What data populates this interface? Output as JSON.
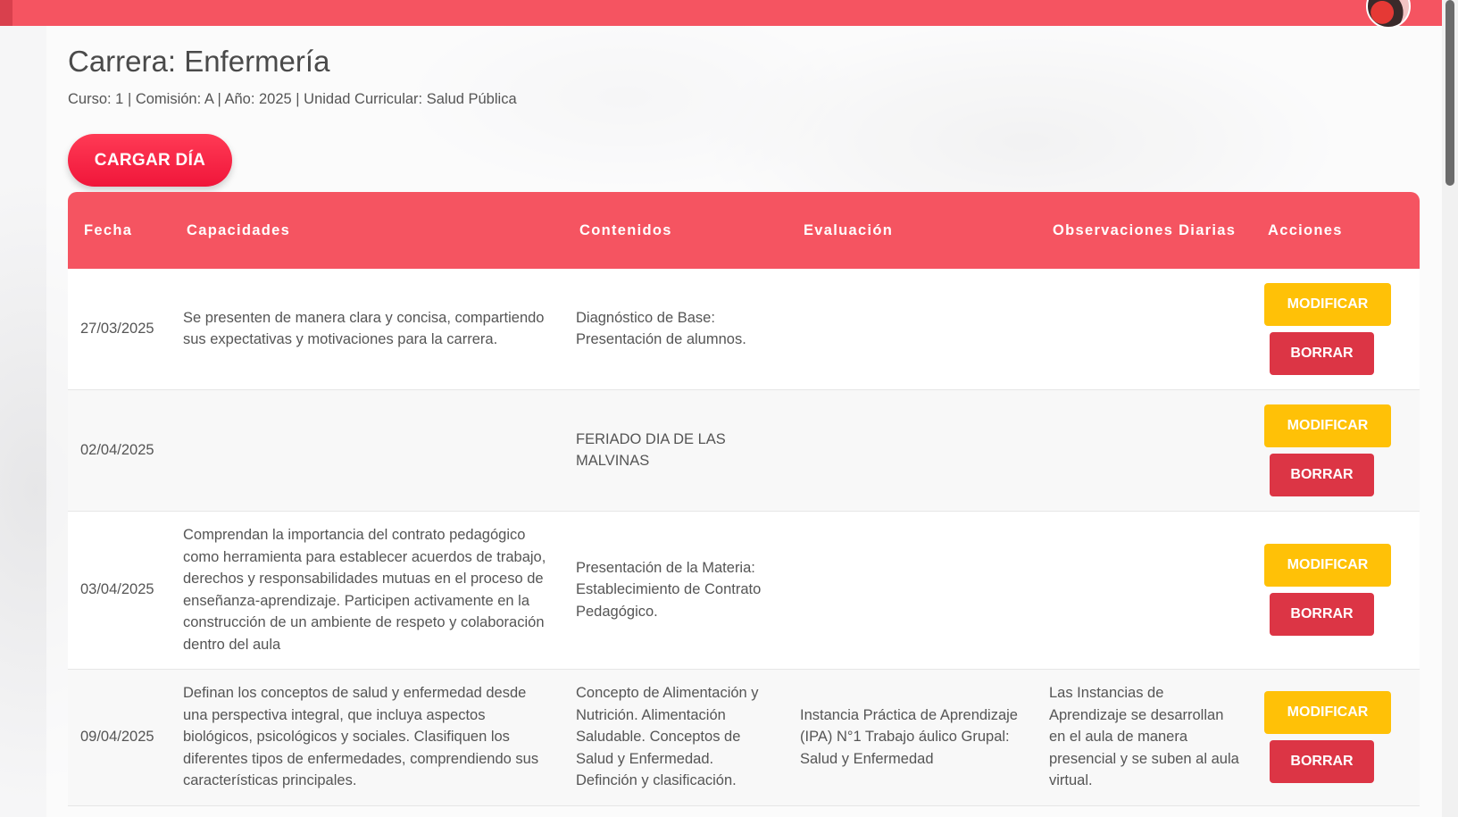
{
  "header": {
    "avatar_icon": "user-avatar",
    "bar_color": "#f55461"
  },
  "page": {
    "title": "Carrera: Enfermería",
    "subtitle": "Curso: 1 | Comisión: A | Año: 2025 | Unidad Curricular: Salud Pública",
    "cargar_label": "CARGAR DÍA"
  },
  "table": {
    "columns": [
      "Fecha",
      "Capacidades",
      "Contenidos",
      "Evaluación",
      "Observaciones Diarias",
      "Acciones"
    ],
    "modify_label": "MODIFICAR",
    "delete_label": "BORRAR",
    "rows": [
      {
        "fecha": "27/03/2025",
        "capacidades": "Se presenten de manera clara y concisa, compartiendo sus expectativas y motivaciones para la carrera.",
        "contenidos": "Diagnóstico de Base: Presentación de alumnos.",
        "evaluacion": "",
        "observaciones": ""
      },
      {
        "fecha": "02/04/2025",
        "capacidades": "",
        "contenidos": "FERIADO DIA DE LAS MALVINAS",
        "evaluacion": "",
        "observaciones": ""
      },
      {
        "fecha": "03/04/2025",
        "capacidades": "Comprendan la importancia del contrato pedagógico como herramienta para establecer acuerdos de trabajo, derechos y responsabilidades mutuas en el proceso de enseñanza-aprendizaje. Participen activamente en la construcción de un ambiente de respeto y colaboración dentro del aula",
        "contenidos": "Presentación de la Materia: Establecimiento de Contrato Pedagógico.",
        "evaluacion": "",
        "observaciones": ""
      },
      {
        "fecha": "09/04/2025",
        "capacidades": "Definan los conceptos de salud y enfermedad desde una perspectiva integral, que incluya aspectos biológicos, psicológicos y sociales. Clasifiquen los diferentes tipos de enfermedades, comprendiendo sus características principales.",
        "contenidos": "Concepto de Alimentación y Nutrición. Alimentación Saludable. Conceptos de Salud y Enfermedad. Definción y clasificación.",
        "evaluacion": "Instancia Práctica de Aprendizaje (IPA) N°1 Trabajo áulico Grupal: Salud y Enfermedad",
        "observaciones": "Las Instancias de Aprendizaje se desarrollan en el aula de manera presencial y se suben al aula virtual."
      }
    ]
  }
}
